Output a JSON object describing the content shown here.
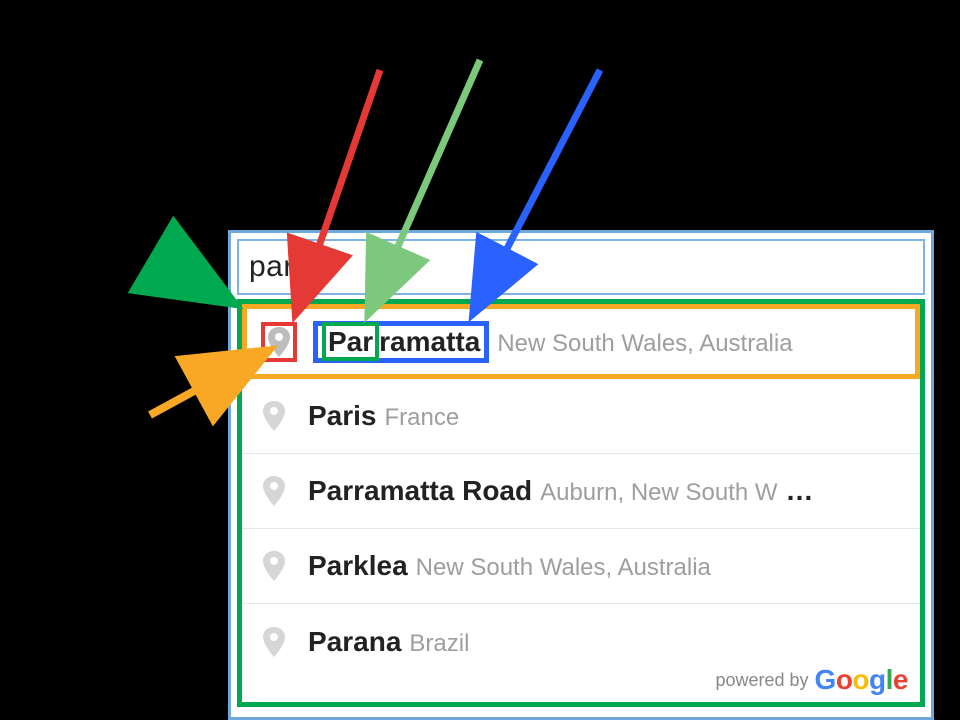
{
  "search": {
    "value": "par"
  },
  "predictions": [
    {
      "matched": "Par",
      "rest": "ramatta",
      "full_main": "Parramatta",
      "secondary": "New South Wales, Australia",
      "highlighted": true
    },
    {
      "matched": "Par",
      "rest": "is",
      "full_main": "Paris",
      "secondary": "France",
      "highlighted": false
    },
    {
      "matched": "Par",
      "rest": "ramatta Road",
      "full_main": "Parramatta Road",
      "secondary": "Auburn, New South W",
      "highlighted": false,
      "truncated": true
    },
    {
      "matched": "Par",
      "rest": "klea",
      "full_main": "Parklea",
      "secondary": "New South Wales, Australia",
      "highlighted": false
    },
    {
      "matched": "Par",
      "rest": "ana",
      "full_main": "Parana",
      "secondary": "Brazil",
      "highlighted": false
    }
  ],
  "attribution": {
    "label": "powered by",
    "brand": "Google"
  },
  "ellipsis": "…",
  "arrows": {
    "colors": {
      "red": "#e53935",
      "green_light": "#7cc97e",
      "blue": "#2962ff",
      "green_dark": "#00a84f",
      "orange": "#f9a825"
    }
  }
}
